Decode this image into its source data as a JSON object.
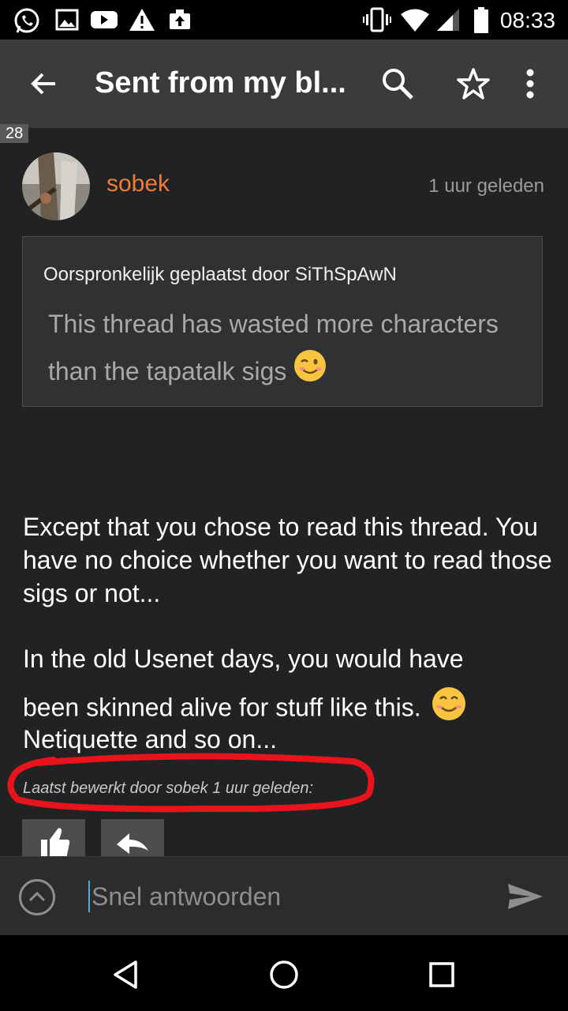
{
  "status_bar": {
    "time": "08:33",
    "icons": [
      "whatsapp-icon",
      "image-icon",
      "youtube-icon",
      "warning-icon",
      "upload-icon",
      "vibrate-icon",
      "wifi-icon",
      "signal-icon",
      "battery-icon"
    ]
  },
  "app_bar": {
    "title": "Sent from my bl...",
    "icons": [
      "back-arrow-icon",
      "search-icon",
      "star-icon",
      "more-vert-icon"
    ]
  },
  "post": {
    "page_badge": "28",
    "author": "sobek",
    "time_ago": "1 uur geleden",
    "quote": {
      "author_line": "Oorspronkelijk geplaatst door SiThSpAwN",
      "text": "This thread has wasted more characters than the tapatalk sigs",
      "emoji": "winking-face-emoji"
    },
    "paragraph1": "Except that you chose to read this thread. You have no choice whether you want to read those sigs or not...",
    "paragraph2_line1": "In the old Usenet days, you would have",
    "paragraph2_line2": "been skinned alive for stuff like this.",
    "paragraph2_line3": "Netiquette and so on...",
    "emoji2": "smiling-face-emoji",
    "edited_note": "Laatst bewerkt door sobek 1 uur geleden:"
  },
  "composer": {
    "placeholder": "Snel antwoorden"
  },
  "colors": {
    "username": "#ef7d3a",
    "background": "#212223",
    "annotation_red": "#e8141b"
  }
}
